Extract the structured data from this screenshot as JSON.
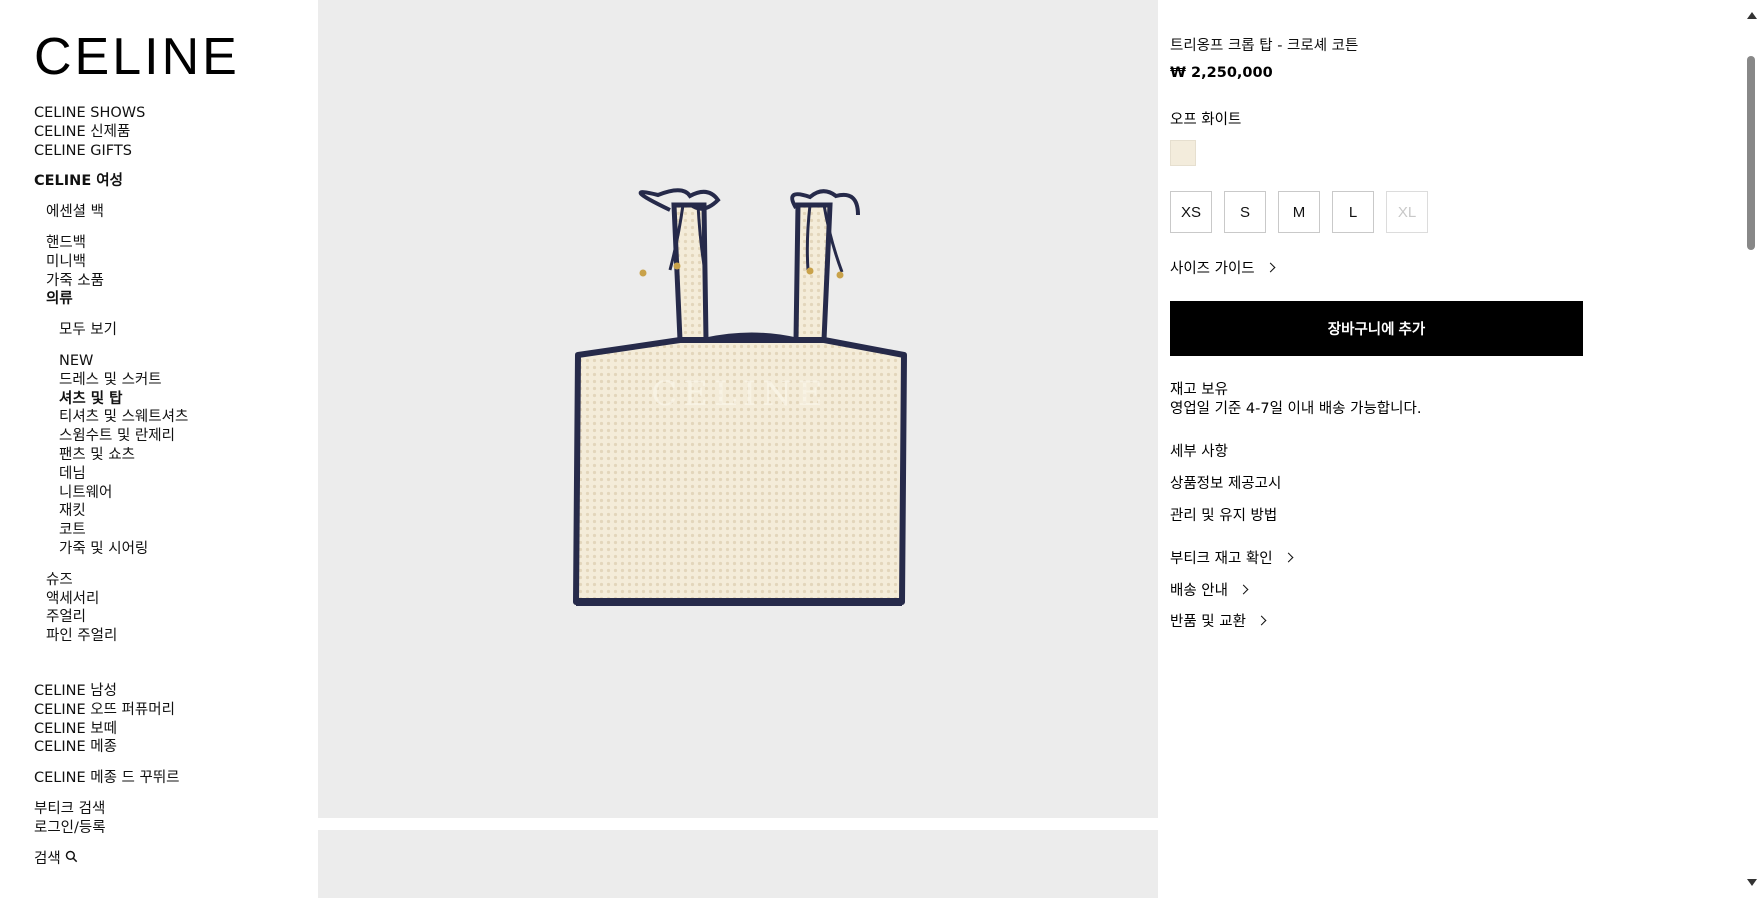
{
  "brand": {
    "logo": "CELINE"
  },
  "sidebar": {
    "top_links": [
      "CELINE SHOWS",
      "CELINE 신제품",
      "CELINE GIFTS"
    ],
    "women_heading": "CELINE 여성",
    "women_groups": {
      "essential": "에센셜 백",
      "bags": [
        "핸드백",
        "미니백",
        "가죽 소품"
      ],
      "clothing_heading": "의류",
      "clothing_all": "모두 보기",
      "clothing_items": [
        "NEW",
        "드레스 및 스커트",
        "셔츠 및 탑",
        "티셔츠 및 스웨트셔츠",
        "스윔수트 및 란제리",
        "팬츠 및 쇼츠",
        "데님",
        "니트웨어",
        "재킷",
        "코트",
        "가죽 및 시어링"
      ],
      "clothing_active": "셔츠 및 탑",
      "others": [
        "슈즈",
        "액세서리",
        "주얼리",
        "파인 주얼리"
      ]
    },
    "bottom_links": [
      "CELINE 남성",
      "CELINE 오뜨 퍼퓨머리",
      "CELINE 보떼",
      "CELINE 메종"
    ],
    "maison_link": "CELINE 메종 드 꾸뛰르",
    "account_links": [
      "부티크 검색",
      "로그인/등록"
    ],
    "search_label": "검색",
    "search_icon": "search-icon"
  },
  "product": {
    "title": "트리옹프 크롭 탑 - 크로셰 코튼",
    "price": "₩ 2,250,000",
    "color_name": "오프 화이트",
    "swatch_color": "#f3ecdc",
    "sizes": [
      {
        "label": "XS",
        "available": true
      },
      {
        "label": "S",
        "available": true
      },
      {
        "label": "M",
        "available": true
      },
      {
        "label": "L",
        "available": true
      },
      {
        "label": "XL",
        "available": false
      }
    ],
    "size_guide": "사이즈 가이드",
    "add_to_cart": "장바구니에 추가",
    "stock_status": "재고 보유",
    "shipping_note": "영업일 기준 4-7일 이내 배송 가능합니다.",
    "details": "세부 사항",
    "product_info": "상품정보 제공고시",
    "care": "관리 및 유지 방법",
    "boutique_stock": "부티크 재고 확인",
    "delivery": "배송 안내",
    "returns": "반품 및 교환"
  },
  "colors": {
    "image_bg": "#ececec",
    "crochet_body": "#f3ead7",
    "crochet_trim": "#262a4a",
    "button_bg": "#000000"
  }
}
